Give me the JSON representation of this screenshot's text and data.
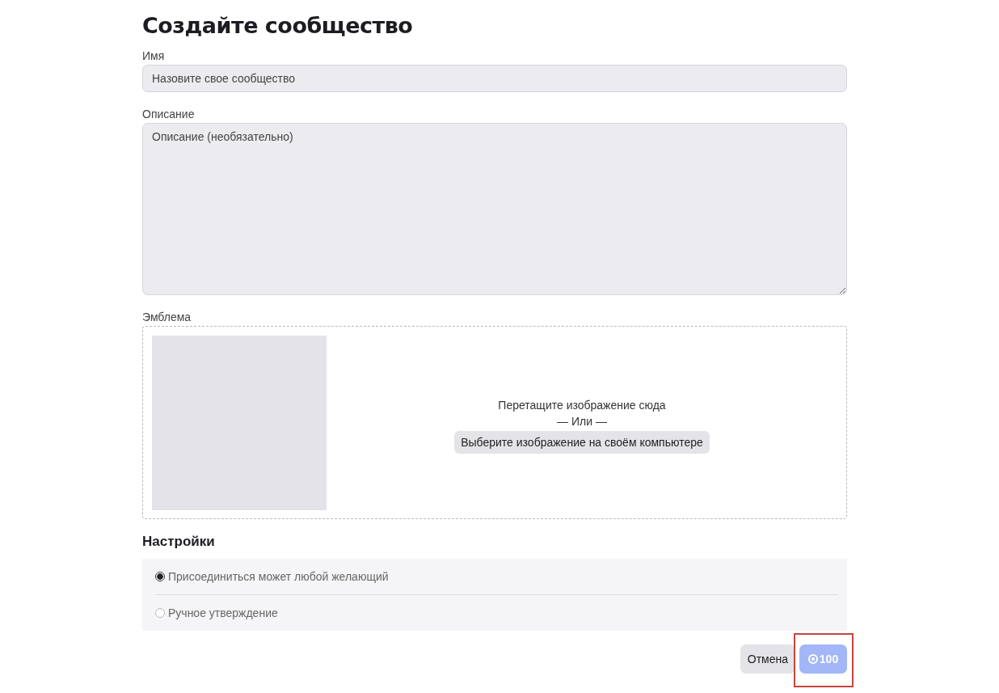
{
  "title": "Создайте сообщество",
  "name_field": {
    "label": "Имя",
    "placeholder": "Назовите свое сообщество"
  },
  "description_field": {
    "label": "Описание",
    "placeholder": "Описание (необязательно)"
  },
  "emblem": {
    "label": "Эмблема",
    "drop_hint": "Перетащите изображение сюда",
    "separator": "— Или —",
    "choose_button": "Выберите изображение на своём компьютере"
  },
  "settings": {
    "heading": "Настройки",
    "options": [
      {
        "label": "Присоединиться может любой желающий",
        "selected": true
      },
      {
        "label": "Ручное утверждение",
        "selected": false
      }
    ]
  },
  "buttons": {
    "cancel": "Отмена",
    "create": {
      "label": "100",
      "disabled": true,
      "highlighted": true
    }
  }
}
